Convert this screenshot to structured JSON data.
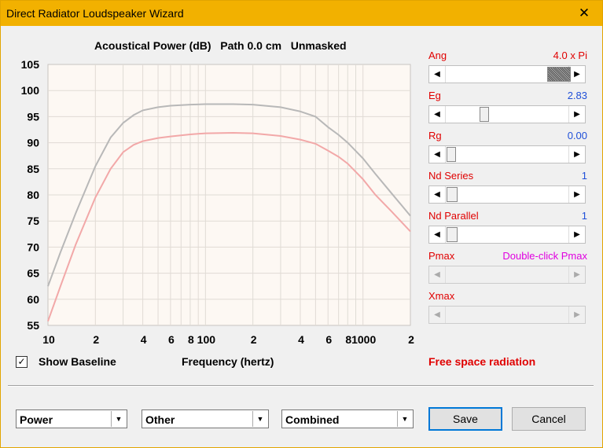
{
  "window": {
    "title": "Direct Radiator Loudspeaker Wizard",
    "close_glyph": "✕"
  },
  "chart_header": "Acoustical Power (dB)   Path 0.0 cm   Unmasked",
  "chart_data": {
    "type": "line",
    "title": "Acoustical Power (dB)   Path 0.0 cm   Unmasked",
    "xlabel": "Frequency (hertz)",
    "ylabel": "",
    "xscale": "log",
    "xlim": [
      10,
      2000
    ],
    "ylim": [
      55,
      105
    ],
    "yticks": [
      55,
      60,
      65,
      70,
      75,
      80,
      85,
      90,
      95,
      100,
      105
    ],
    "xticks": [
      {
        "v": 10,
        "label": "10"
      },
      {
        "v": 20,
        "label": "2"
      },
      {
        "v": 40,
        "label": "4"
      },
      {
        "v": 60,
        "label": "6"
      },
      {
        "v": 80,
        "label": "8"
      },
      {
        "v": 100,
        "label": "100"
      },
      {
        "v": 200,
        "label": "2"
      },
      {
        "v": 400,
        "label": "4"
      },
      {
        "v": 600,
        "label": "6"
      },
      {
        "v": 800,
        "label": "8"
      },
      {
        "v": 1000,
        "label": "1000"
      },
      {
        "v": 2000,
        "label": "2"
      }
    ],
    "grid": true,
    "colors": {
      "background": "#fdf8f3",
      "grid": "#e0dbd5",
      "series_gray": "#b8b8b8",
      "series_pink": "#f2a8a8"
    },
    "series": [
      {
        "x": [
          10,
          12,
          15,
          20,
          25,
          30,
          35,
          40,
          50,
          60,
          80,
          100,
          150,
          200,
          300,
          400,
          500,
          600,
          700,
          800,
          1000,
          1200,
          1500,
          2000
        ],
        "values": [
          62.5,
          69,
          76.5,
          85.5,
          91,
          93.8,
          95.3,
          96.2,
          96.8,
          97.1,
          97.3,
          97.4,
          97.4,
          97.3,
          96.8,
          96,
          95,
          93,
          91.5,
          90,
          87,
          84,
          80.5,
          76
        ]
      },
      {
        "x": [
          10,
          12,
          15,
          20,
          25,
          30,
          35,
          40,
          50,
          60,
          80,
          100,
          150,
          200,
          300,
          400,
          500,
          600,
          700,
          800,
          1000,
          1200,
          1500,
          2000
        ],
        "values": [
          55.8,
          62.5,
          70.5,
          79.5,
          85,
          88.2,
          89.6,
          90.3,
          90.9,
          91.2,
          91.6,
          91.8,
          91.9,
          91.8,
          91.3,
          90.6,
          89.8,
          88.5,
          87.3,
          86,
          83,
          80,
          77,
          73
        ]
      }
    ]
  },
  "sliders": [
    {
      "name": "Ang",
      "value": "4.0 x Pi",
      "value_color": "#e00000",
      "thumb_left": 150,
      "thumb_w": 30,
      "dotted": true,
      "disabled": false
    },
    {
      "name": "Eg",
      "value": "2.83",
      "value_color": "#1f4fd8",
      "thumb_left": 64,
      "thumb_w": 12,
      "dotted": false,
      "disabled": false
    },
    {
      "name": "Rg",
      "value": "0.00",
      "value_color": "#1f4fd8",
      "thumb_left": 22,
      "thumb_w": 12,
      "dotted": false,
      "disabled": false
    },
    {
      "name": "Nd  Series",
      "value": "1",
      "value_color": "#1f4fd8",
      "thumb_left": 22,
      "thumb_w": 14,
      "dotted": false,
      "disabled": false
    },
    {
      "name": "Nd  Parallel",
      "value": "1",
      "value_color": "#1f4fd8",
      "thumb_left": 22,
      "thumb_w": 14,
      "dotted": false,
      "disabled": false
    },
    {
      "name": "Pmax",
      "value": "Double-click Pmax",
      "value_color": "#e000e0",
      "thumb_left": 0,
      "thumb_w": 0,
      "dotted": false,
      "disabled": true
    },
    {
      "name": "Xmax",
      "value": "",
      "value_color": "#1f4fd8",
      "thumb_left": 0,
      "thumb_w": 0,
      "dotted": false,
      "disabled": true
    }
  ],
  "show_baseline": {
    "label": "Show Baseline",
    "checked": "✓"
  },
  "free_space": "Free space radiation",
  "dropdowns": {
    "d1": "Power",
    "d2": "Other",
    "d3": "Combined",
    "arrow": "▼"
  },
  "buttons": {
    "save": "Save",
    "cancel": "Cancel"
  },
  "arrows": {
    "left": "◀",
    "right": "▶"
  }
}
